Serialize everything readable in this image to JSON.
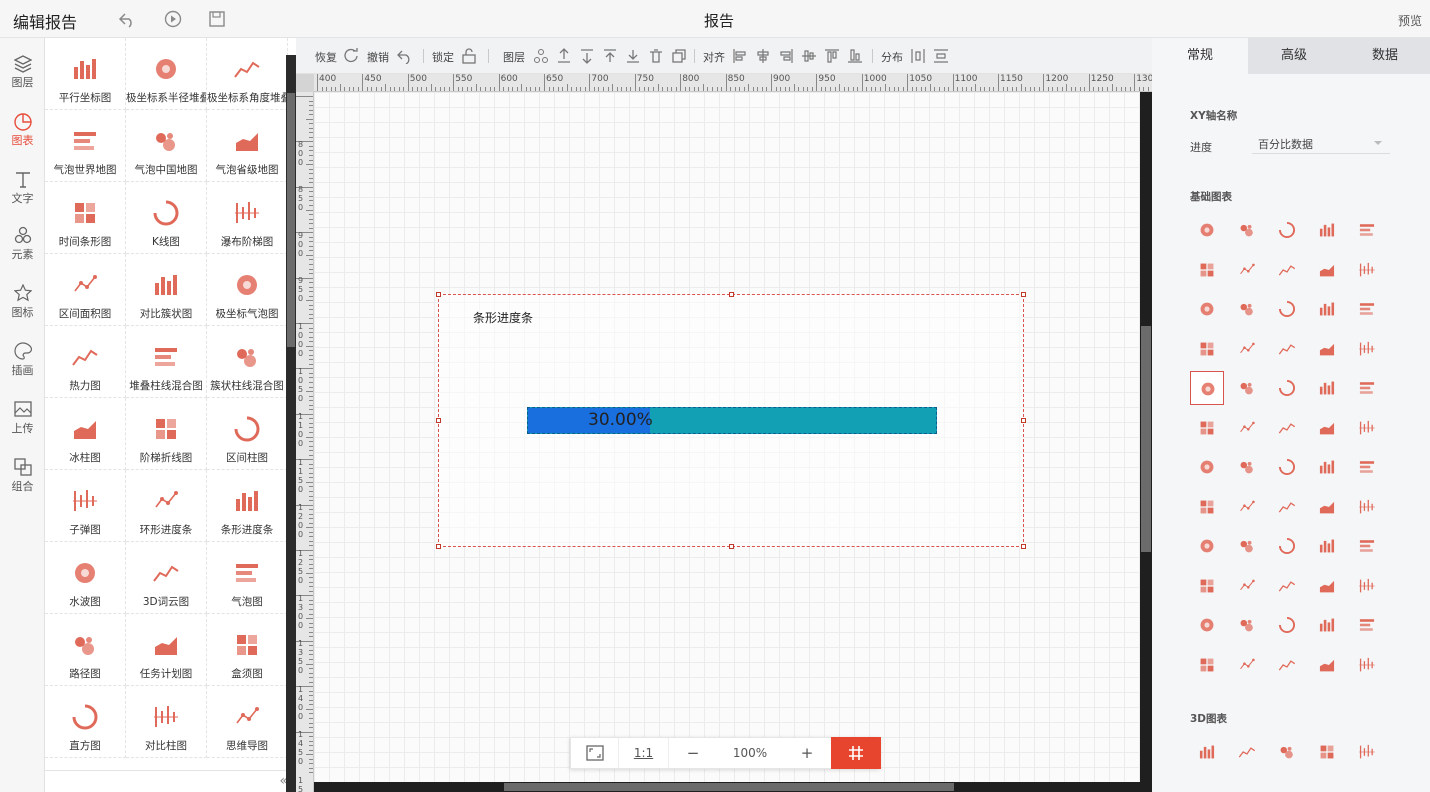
{
  "header": {
    "app_title": "编辑报告",
    "doc_title": "报告",
    "preview": "预览"
  },
  "left_nav": [
    {
      "label": "图层",
      "icon": "layers-icon"
    },
    {
      "label": "图表",
      "icon": "chart-pie-icon",
      "active": true
    },
    {
      "label": "文字",
      "icon": "text-icon"
    },
    {
      "label": "元素",
      "icon": "element-icon"
    },
    {
      "label": "图标",
      "icon": "star-icon"
    },
    {
      "label": "插画",
      "icon": "palette-icon"
    },
    {
      "label": "上传",
      "icon": "image-upload-icon"
    },
    {
      "label": "组合",
      "icon": "group-icon"
    }
  ],
  "gallery": [
    {
      "label": "平行坐标图",
      "icon": "parallel-icon"
    },
    {
      "label": "极坐标系半径堆叠",
      "icon": "polar-radius-icon"
    },
    {
      "label": "极坐标系角度堆叠",
      "icon": "polar-angle-icon"
    },
    {
      "label": "气泡世界地图",
      "icon": "world-map-icon"
    },
    {
      "label": "气泡中国地图",
      "icon": "china-map-icon"
    },
    {
      "label": "气泡省级地图",
      "icon": "province-map-icon"
    },
    {
      "label": "时间条形图",
      "icon": "time-bar-icon"
    },
    {
      "label": "K线图",
      "icon": "candlestick-icon"
    },
    {
      "label": "瀑布阶梯图",
      "icon": "waterfall-icon"
    },
    {
      "label": "区间面积图",
      "icon": "range-area-icon"
    },
    {
      "label": "对比簇状图",
      "icon": "cluster-bar-icon"
    },
    {
      "label": "极坐标气泡图",
      "icon": "polar-bubble-icon"
    },
    {
      "label": "热力图",
      "icon": "heatmap-icon"
    },
    {
      "label": "堆叠柱线混合图",
      "icon": "stacked-combo-icon"
    },
    {
      "label": "簇状柱线混合图",
      "icon": "cluster-combo-icon"
    },
    {
      "label": "冰柱图",
      "icon": "icicle-icon"
    },
    {
      "label": "阶梯折线图",
      "icon": "step-line-icon"
    },
    {
      "label": "区间柱图",
      "icon": "range-bar-icon"
    },
    {
      "label": "子弹图",
      "icon": "bullet-icon"
    },
    {
      "label": "环形进度条",
      "icon": "ring-progress-icon"
    },
    {
      "label": "条形进度条",
      "icon": "bar-progress-icon"
    },
    {
      "label": "水波图",
      "icon": "liquid-icon"
    },
    {
      "label": "3D词云图",
      "icon": "wordcloud-icon"
    },
    {
      "label": "气泡图",
      "icon": "bubble-icon"
    },
    {
      "label": "路径图",
      "icon": "path-icon"
    },
    {
      "label": "任务计划图",
      "icon": "gantt-icon"
    },
    {
      "label": "盒须图",
      "icon": "boxplot-icon"
    },
    {
      "label": "直方图",
      "icon": "histogram-icon"
    },
    {
      "label": "对比柱图",
      "icon": "compare-bar-icon"
    },
    {
      "label": "思维导图",
      "icon": "mindmap-icon"
    }
  ],
  "toolbar": {
    "redo": "恢复",
    "undo": "撤销",
    "lock": "锁定",
    "layer": "图层",
    "align": "对齐",
    "distribute": "分布"
  },
  "ruler": {
    "h_labels": [
      "400",
      "450",
      "500",
      "550",
      "600",
      "650",
      "700",
      "750",
      "800",
      "850",
      "900",
      "950",
      "1000",
      "1050",
      "1100",
      "1150",
      "1200",
      "1250",
      "1300"
    ],
    "v_labels": [
      "800",
      "850",
      "900",
      "950",
      "1000",
      "1050",
      "1100",
      "1150",
      "1200",
      "1250",
      "1300",
      "1350",
      "1400",
      "1450",
      "1500"
    ]
  },
  "widget": {
    "title": "条形进度条",
    "percent": 0.3,
    "value_text": "30.00%",
    "fill_color": "#1a6fde",
    "track_color": "#12a0b4"
  },
  "zoom": {
    "fit_icon": "fit-screen-icon",
    "ratio": "1:1",
    "minus": "−",
    "level": "100%",
    "plus": "+",
    "grid_icon": "grid-icon"
  },
  "right_panel": {
    "tabs": [
      "常规",
      "高级",
      "数据"
    ],
    "xy_section": "XY轴名称",
    "progress_label": "进度",
    "progress_value": "百分比数据",
    "basic_section": "基础图表",
    "three_d_section": "3D图表"
  },
  "colors": {
    "accent": "#e8452e",
    "icon": "#e06a5a"
  }
}
